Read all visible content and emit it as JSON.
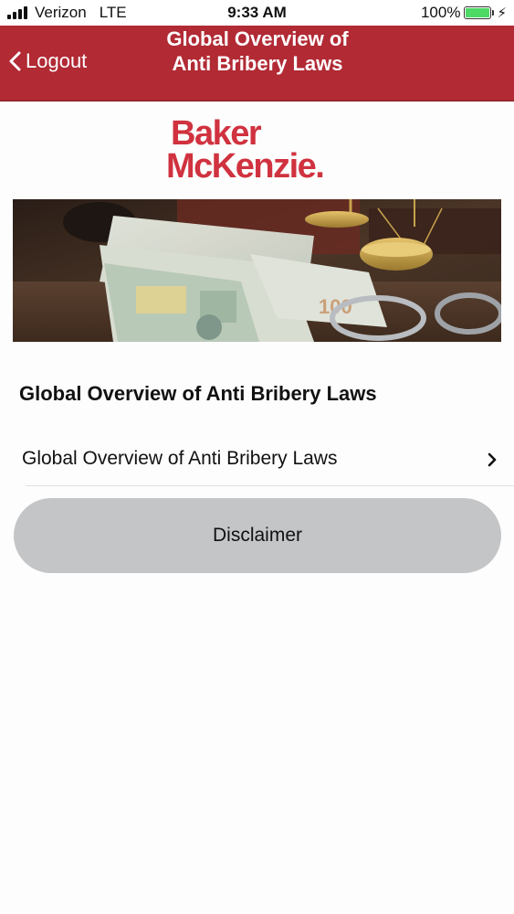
{
  "status_bar": {
    "carrier": "Verizon",
    "network": "LTE",
    "time": "9:33 AM",
    "battery": "100%",
    "battery_color": "#4cd964"
  },
  "nav": {
    "back_label": "Logout",
    "title": "Global Overview of Anti Bribery Laws",
    "background": "#b12a34"
  },
  "logo": {
    "line1": "Baker",
    "line2": "McKenzie.",
    "color": "#d0323f"
  },
  "banner": {
    "description_icon": "money-scales-handcuffs-image"
  },
  "section": {
    "title": "Global Overview of Anti Bribery Laws"
  },
  "list": {
    "items": [
      {
        "label": "Global Overview of Anti Bribery Laws",
        "icon": "chevron-right-icon"
      }
    ]
  },
  "disclaimer": {
    "label": "Disclaimer"
  }
}
